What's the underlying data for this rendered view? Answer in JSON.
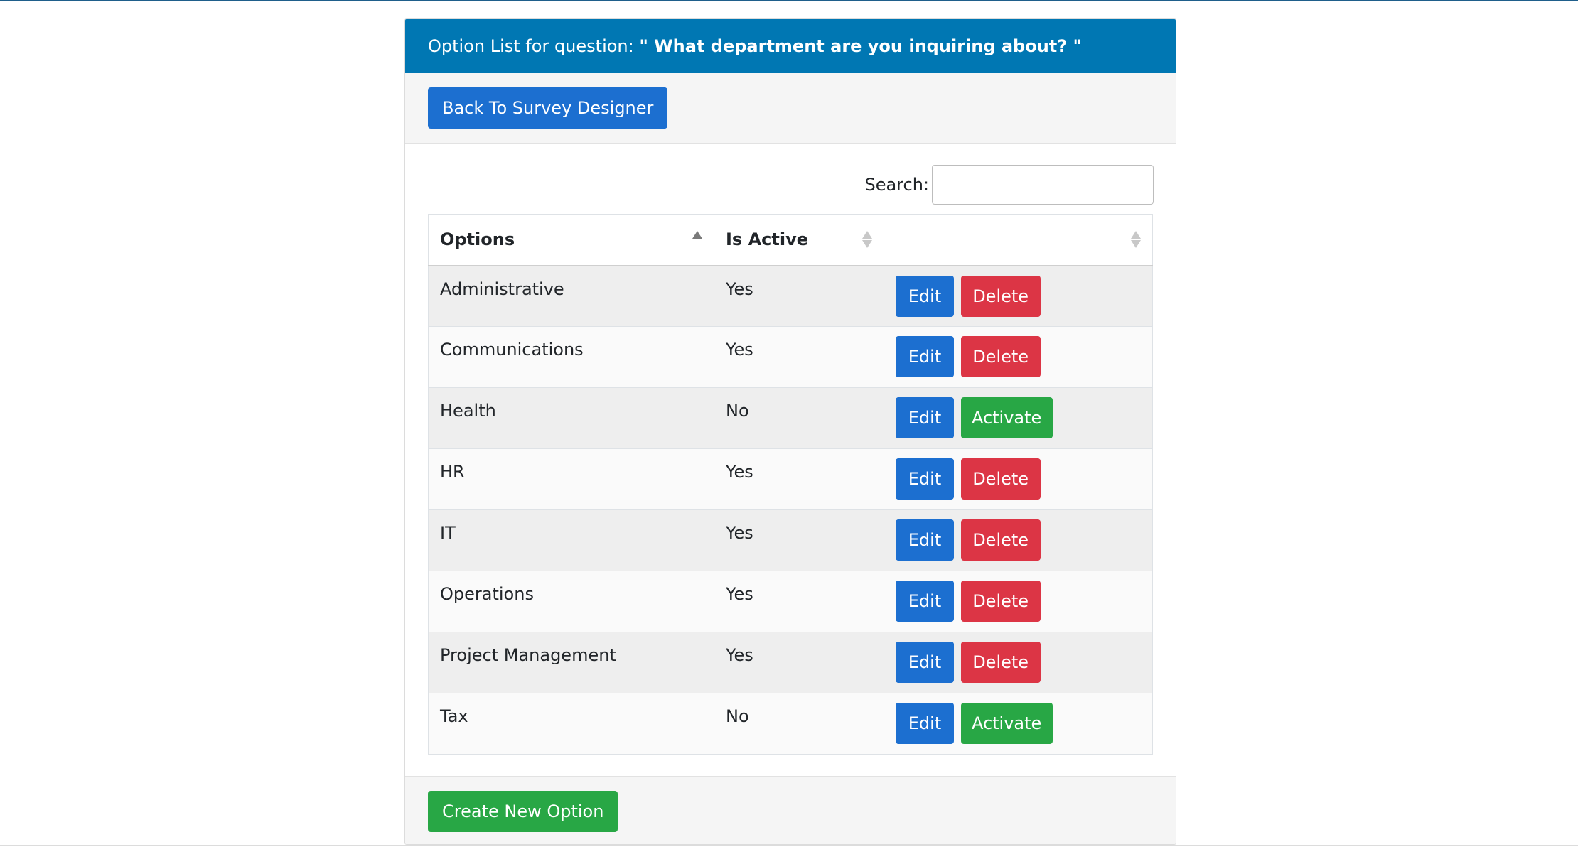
{
  "header": {
    "prefix": "Option List for question: ",
    "question": "\" What department are you inquiring about? \""
  },
  "toolbar": {
    "back_label": "Back To Survey Designer"
  },
  "search": {
    "label": "Search:",
    "value": ""
  },
  "table": {
    "columns": [
      "Options",
      "Is Active",
      ""
    ],
    "rows": [
      {
        "option": "Administrative",
        "active": "Yes",
        "edit": "Edit",
        "action": "Delete"
      },
      {
        "option": "Communications",
        "active": "Yes",
        "edit": "Edit",
        "action": "Delete"
      },
      {
        "option": "Health",
        "active": "No",
        "edit": "Edit",
        "action": "Activate"
      },
      {
        "option": "HR",
        "active": "Yes",
        "edit": "Edit",
        "action": "Delete"
      },
      {
        "option": "IT",
        "active": "Yes",
        "edit": "Edit",
        "action": "Delete"
      },
      {
        "option": "Operations",
        "active": "Yes",
        "edit": "Edit",
        "action": "Delete"
      },
      {
        "option": "Project Management",
        "active": "Yes",
        "edit": "Edit",
        "action": "Delete"
      },
      {
        "option": "Tax",
        "active": "No",
        "edit": "Edit",
        "action": "Activate"
      }
    ]
  },
  "footer": {
    "create_label": "Create New Option"
  },
  "colors": {
    "header_bg": "#0077b3",
    "primary": "#1c6fd0",
    "danger": "#dc3545",
    "success": "#28a745"
  },
  "icons": {
    "sort_icon": "sort-arrows-icon"
  }
}
